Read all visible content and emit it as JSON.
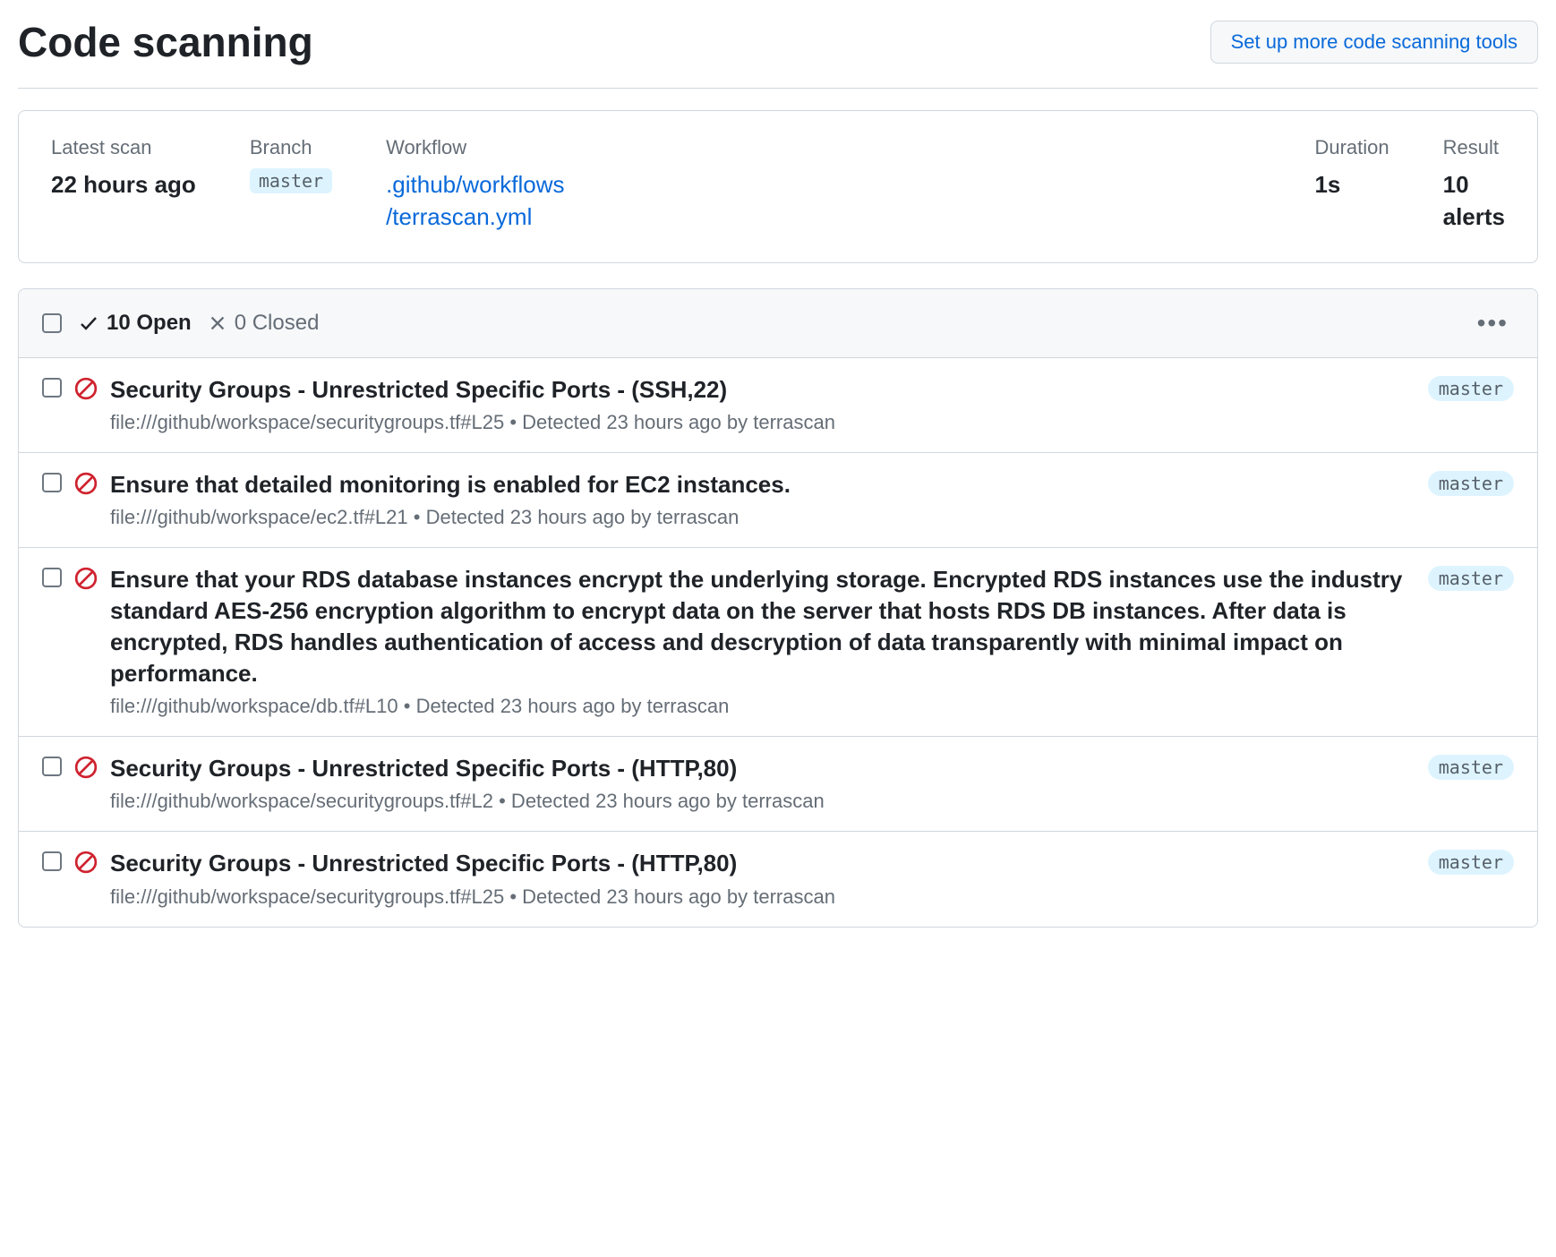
{
  "header": {
    "title": "Code scanning",
    "setup_button": "Set up more code scanning tools"
  },
  "summary": {
    "latest_scan_label": "Latest scan",
    "latest_scan_value": "22 hours ago",
    "branch_label": "Branch",
    "branch_value": "master",
    "workflow_label": "Workflow",
    "workflow_line1": ".github/workflows",
    "workflow_line2": "/terrascan.yml",
    "duration_label": "Duration",
    "duration_value": "1s",
    "result_label": "Result",
    "result_line1": "10",
    "result_line2": "alerts"
  },
  "tabs": {
    "open": "10 Open",
    "closed": "0 Closed"
  },
  "alerts": [
    {
      "title": "Security Groups - Unrestricted Specific Ports - (SSH,22)",
      "meta": "file:///github/workspace/securitygroups.tf#L25 • Detected 23 hours ago by terrascan",
      "branch": "master"
    },
    {
      "title": "Ensure that detailed monitoring is enabled for EC2 instances.",
      "meta": "file:///github/workspace/ec2.tf#L21 • Detected 23 hours ago by terrascan",
      "branch": "master"
    },
    {
      "title": "Ensure that your RDS database instances encrypt the underlying storage. Encrypted RDS instances use the industry standard AES-256 encryption algorithm to encrypt data on the server that hosts RDS DB instances. After data is encrypted, RDS handles authentication of access and descryption of data transparently with minimal impact on performance.",
      "meta": "file:///github/workspace/db.tf#L10 • Detected 23 hours ago by terrascan",
      "branch": "master"
    },
    {
      "title": "Security Groups - Unrestricted Specific Ports - (HTTP,80)",
      "meta": "file:///github/workspace/securitygroups.tf#L2 • Detected 23 hours ago by terrascan",
      "branch": "master"
    },
    {
      "title": "Security Groups - Unrestricted Specific Ports - (HTTP,80)",
      "meta": "file:///github/workspace/securitygroups.tf#L25 • Detected 23 hours ago by terrascan",
      "branch": "master"
    }
  ]
}
